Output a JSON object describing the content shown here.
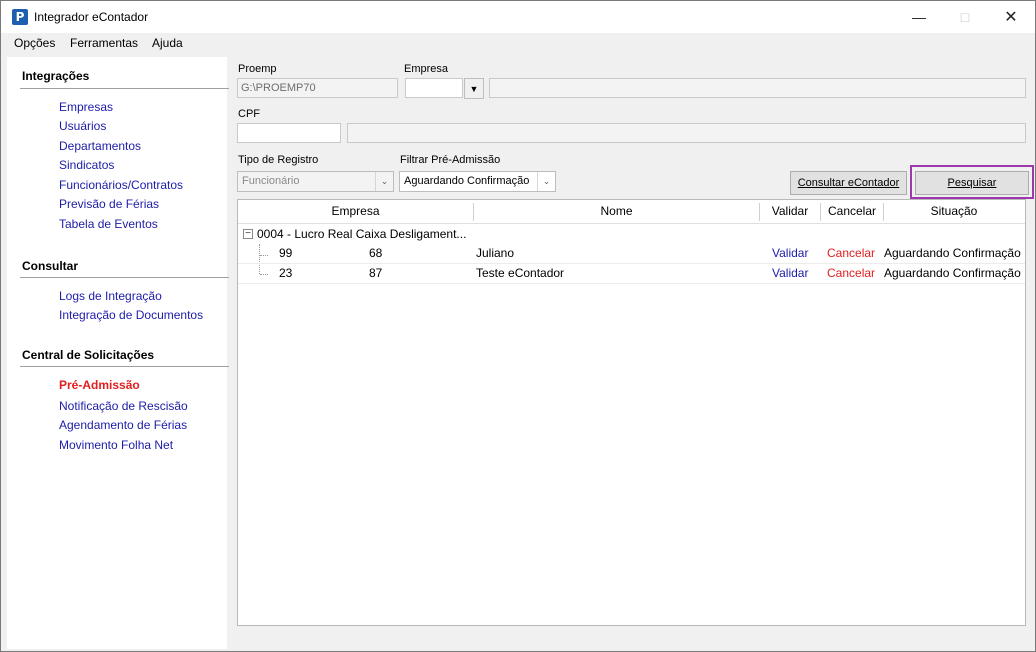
{
  "window": {
    "app_icon_letter": "P",
    "title": "Integrador eContador",
    "controls": {
      "minimize": "—",
      "maximize": "□",
      "close": "✕"
    }
  },
  "menu": {
    "items": [
      "Opções",
      "Ferramentas",
      "Ajuda"
    ]
  },
  "sidebar": {
    "sections": [
      {
        "title": "Integrações",
        "links": [
          "Empresas",
          "Usuários",
          "Departamentos",
          "Sindicatos",
          "Funcionários/Contratos",
          "Previsão de Férias",
          "Tabela de Eventos"
        ]
      },
      {
        "title": "Consultar",
        "links": [
          "Logs de Integração",
          "Integração de Documentos"
        ]
      },
      {
        "title": "Central de Solicitações",
        "links": [
          "Pré-Admissão",
          "Notificação de Rescisão",
          "Agendamento de Férias",
          "Movimento Folha Net"
        ]
      }
    ],
    "active_link": "Pré-Admissão"
  },
  "form": {
    "proemp_label": "Proemp",
    "proemp_value": "G:\\PROEMP70",
    "empresa_label": "Empresa",
    "empresa_value": "",
    "empresa_name": "",
    "cpf_label": "CPF",
    "cpf_value": "",
    "cpf_name": "",
    "tipo_label": "Tipo de Registro",
    "tipo_value": "Funcionário",
    "filtro_label": "Filtrar Pré-Admissão",
    "filtro_value": "Aguardando Confirmação",
    "consultar_button": "Consultar eContador",
    "pesquisar_button": "Pesquisar"
  },
  "grid": {
    "columns": [
      "Empresa",
      "Nome",
      "Validar",
      "Cancelar",
      "Situação"
    ],
    "group_label": "0004 - Lucro Real Caixa Desligament...",
    "rows": [
      {
        "id": "99",
        "empresa": "68",
        "nome": "Juliano",
        "validar": "Validar",
        "cancelar": "Cancelar",
        "situacao": "Aguardando Confirmação"
      },
      {
        "id": "23",
        "empresa": "87",
        "nome": "Teste eContador",
        "validar": "Validar",
        "cancelar": "Cancelar",
        "situacao": "Aguardando Confirmação"
      }
    ]
  },
  "colors": {
    "link": "#1c1ca8",
    "active_link": "#e01e1e",
    "highlight": "#9b3aa8"
  }
}
